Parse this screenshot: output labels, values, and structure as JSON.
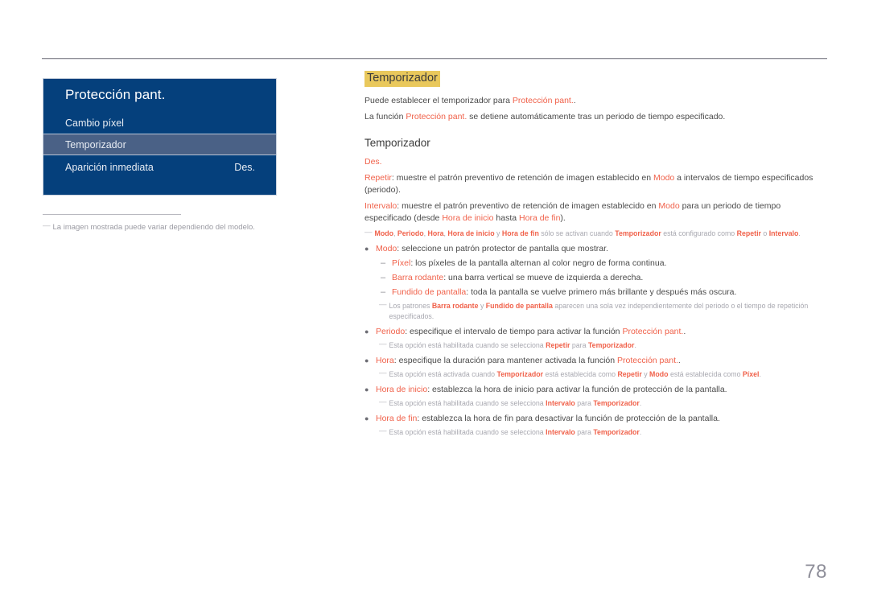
{
  "page": {
    "number": "78"
  },
  "osd": {
    "title": "Protección pant.",
    "rows": [
      {
        "label": "Cambio píxel",
        "value": ""
      },
      {
        "label": "Temporizador",
        "value": ""
      },
      {
        "label": "Aparición inmediata",
        "value": "Des."
      }
    ]
  },
  "left_note": {
    "dash": "―",
    "text": "La imagen mostrada puede variar dependiendo del modelo."
  },
  "content": {
    "heading": "Temporizador",
    "intro": [
      {
        "parts": [
          {
            "t": "Puede establecer el temporizador para ",
            "s": "n"
          },
          {
            "t": "Protección pant.",
            "s": "e"
          },
          {
            "t": ".",
            "s": "n"
          }
        ]
      },
      {
        "parts": [
          {
            "t": "La función ",
            "s": "n"
          },
          {
            "t": "Protección pant.",
            "s": "e"
          },
          {
            "t": " se detiene automáticamente tras un periodo de tiempo especificado.",
            "s": "n"
          }
        ]
      }
    ],
    "sub_heading": "Temporizador",
    "options": [
      {
        "parts": [
          {
            "t": "Des.",
            "s": "e"
          }
        ]
      },
      {
        "parts": [
          {
            "t": "Repetir",
            "s": "e"
          },
          {
            "t": ": muestre el patrón preventivo de retención de imagen establecido en ",
            "s": "n"
          },
          {
            "t": "Modo",
            "s": "e"
          },
          {
            "t": " a intervalos de tiempo especificados (periodo).",
            "s": "n"
          }
        ]
      },
      {
        "parts": [
          {
            "t": "Intervalo",
            "s": "e"
          },
          {
            "t": ": muestre el patrón preventivo de retención de imagen establecido en ",
            "s": "n"
          },
          {
            "t": "Modo",
            "s": "e"
          },
          {
            "t": " para un periodo de tiempo especificado (desde ",
            "s": "n"
          },
          {
            "t": "Hora de inicio",
            "s": "e"
          },
          {
            "t": " hasta ",
            "s": "n"
          },
          {
            "t": "Hora de fin",
            "s": "e"
          },
          {
            "t": ").",
            "s": "n"
          }
        ]
      }
    ],
    "note_top": {
      "dash": "―",
      "parts": [
        {
          "t": "Modo",
          "s": "en"
        },
        {
          "t": ", ",
          "s": "n"
        },
        {
          "t": "Periodo",
          "s": "en"
        },
        {
          "t": ", ",
          "s": "n"
        },
        {
          "t": "Hora",
          "s": "en"
        },
        {
          "t": ", ",
          "s": "n"
        },
        {
          "t": "Hora de inicio",
          "s": "en"
        },
        {
          "t": " y ",
          "s": "n"
        },
        {
          "t": "Hora de fin",
          "s": "en"
        },
        {
          "t": " sólo se activan cuando ",
          "s": "n"
        },
        {
          "t": "Temporizador",
          "s": "en"
        },
        {
          "t": " está configurado como ",
          "s": "n"
        },
        {
          "t": "Repetir",
          "s": "en"
        },
        {
          "t": " o ",
          "s": "n"
        },
        {
          "t": "Intervalo",
          "s": "en"
        },
        {
          "t": ".",
          "s": "n"
        }
      ]
    },
    "blocks": [
      {
        "kind": "bullet",
        "mark": "●",
        "parts": [
          {
            "t": "Modo",
            "s": "e"
          },
          {
            "t": ": seleccione un patrón protector de pantalla que mostrar.",
            "s": "n"
          }
        ]
      },
      {
        "kind": "subbullet",
        "mark": "–",
        "parts": [
          {
            "t": "Píxel",
            "s": "e"
          },
          {
            "t": ": los píxeles de la pantalla alternan al color negro de forma continua.",
            "s": "n"
          }
        ]
      },
      {
        "kind": "subbullet",
        "mark": "–",
        "parts": [
          {
            "t": "Barra rodante",
            "s": "e"
          },
          {
            "t": ": una barra vertical se mueve de izquierda a derecha.",
            "s": "n"
          }
        ]
      },
      {
        "kind": "subbullet",
        "mark": "–",
        "parts": [
          {
            "t": "Fundido de pantalla",
            "s": "e"
          },
          {
            "t": ": toda la pantalla se vuelve primero más brillante y después más oscura.",
            "s": "n"
          }
        ]
      },
      {
        "kind": "note",
        "indent": 2,
        "dash": "―",
        "parts": [
          {
            "t": "Los patrones ",
            "s": "n"
          },
          {
            "t": "Barra rodante",
            "s": "en"
          },
          {
            "t": " y ",
            "s": "n"
          },
          {
            "t": "Fundido de pantalla",
            "s": "en"
          },
          {
            "t": " aparecen una sola vez independientemente del periodo o el tiempo de repetición especificados.",
            "s": "n"
          }
        ]
      },
      {
        "kind": "bullet",
        "mark": "●",
        "parts": [
          {
            "t": "Periodo",
            "s": "e"
          },
          {
            "t": ": especifique el intervalo de tiempo para activar la función ",
            "s": "n"
          },
          {
            "t": "Protección pant.",
            "s": "e"
          },
          {
            "t": ".",
            "s": "n"
          }
        ]
      },
      {
        "kind": "note",
        "indent": 1,
        "dash": "―",
        "parts": [
          {
            "t": "Esta opción está habilitada cuando se selecciona ",
            "s": "n"
          },
          {
            "t": "Repetir",
            "s": "en"
          },
          {
            "t": " para ",
            "s": "n"
          },
          {
            "t": "Temporizador",
            "s": "en"
          },
          {
            "t": ".",
            "s": "n"
          }
        ]
      },
      {
        "kind": "bullet",
        "mark": "●",
        "parts": [
          {
            "t": "Hora",
            "s": "e"
          },
          {
            "t": ": especifique la duración para mantener activada la función ",
            "s": "n"
          },
          {
            "t": "Protección pant.",
            "s": "e"
          },
          {
            "t": ".",
            "s": "n"
          }
        ]
      },
      {
        "kind": "note",
        "indent": 1,
        "dash": "―",
        "parts": [
          {
            "t": "Esta opción está activada cuando ",
            "s": "n"
          },
          {
            "t": "Temporizador",
            "s": "en"
          },
          {
            "t": " está establecida como ",
            "s": "n"
          },
          {
            "t": "Repetir",
            "s": "en"
          },
          {
            "t": " y ",
            "s": "n"
          },
          {
            "t": "Modo",
            "s": "en"
          },
          {
            "t": " está establecida como ",
            "s": "n"
          },
          {
            "t": "Píxel",
            "s": "en"
          },
          {
            "t": ".",
            "s": "n"
          }
        ]
      },
      {
        "kind": "bullet",
        "mark": "●",
        "parts": [
          {
            "t": "Hora de inicio",
            "s": "e"
          },
          {
            "t": ": establezca la hora de inicio para activar la función de protección de la pantalla.",
            "s": "n"
          }
        ]
      },
      {
        "kind": "note",
        "indent": 1,
        "dash": "―",
        "parts": [
          {
            "t": "Esta opción está habilitada cuando se selecciona ",
            "s": "n"
          },
          {
            "t": "Intervalo",
            "s": "en"
          },
          {
            "t": " para ",
            "s": "n"
          },
          {
            "t": "Temporizador",
            "s": "en"
          },
          {
            "t": ".",
            "s": "n"
          }
        ]
      },
      {
        "kind": "bullet",
        "mark": "●",
        "parts": [
          {
            "t": "Hora de fin",
            "s": "e"
          },
          {
            "t": ": establezca la hora de fin para desactivar la función de protección de la pantalla.",
            "s": "n"
          }
        ]
      },
      {
        "kind": "note",
        "indent": 1,
        "dash": "―",
        "parts": [
          {
            "t": "Esta opción está habilitada cuando se selecciona ",
            "s": "n"
          },
          {
            "t": "Intervalo",
            "s": "en"
          },
          {
            "t": " para ",
            "s": "n"
          },
          {
            "t": "Temporizador",
            "s": "en"
          },
          {
            "t": ".",
            "s": "n"
          }
        ]
      }
    ]
  },
  "colors": {
    "osd_background": "#05407c",
    "osd_selected": "#4a6186",
    "highlight": "#e9c85c",
    "emphasis": "#f0614a",
    "note_grey": "#a8a8b0",
    "page_number": "#8e8e99"
  }
}
